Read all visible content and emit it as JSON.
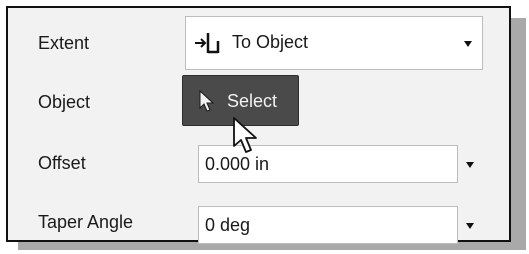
{
  "fields": {
    "extent": {
      "label": "Extent",
      "value": "To Object",
      "icon": "to-object-icon"
    },
    "object": {
      "label": "Object",
      "button_label": "Select",
      "button_icon": "select-arrow-icon"
    },
    "offset": {
      "label": "Offset",
      "value": "0.000 in"
    },
    "taper_angle": {
      "label": "Taper Angle",
      "value": "0 deg"
    }
  },
  "colors": {
    "panel_background": "#f2f2f2",
    "select_button_background": "#4a4a4a",
    "select_button_text": "#f2f2f2",
    "input_background": "#ffffff"
  }
}
